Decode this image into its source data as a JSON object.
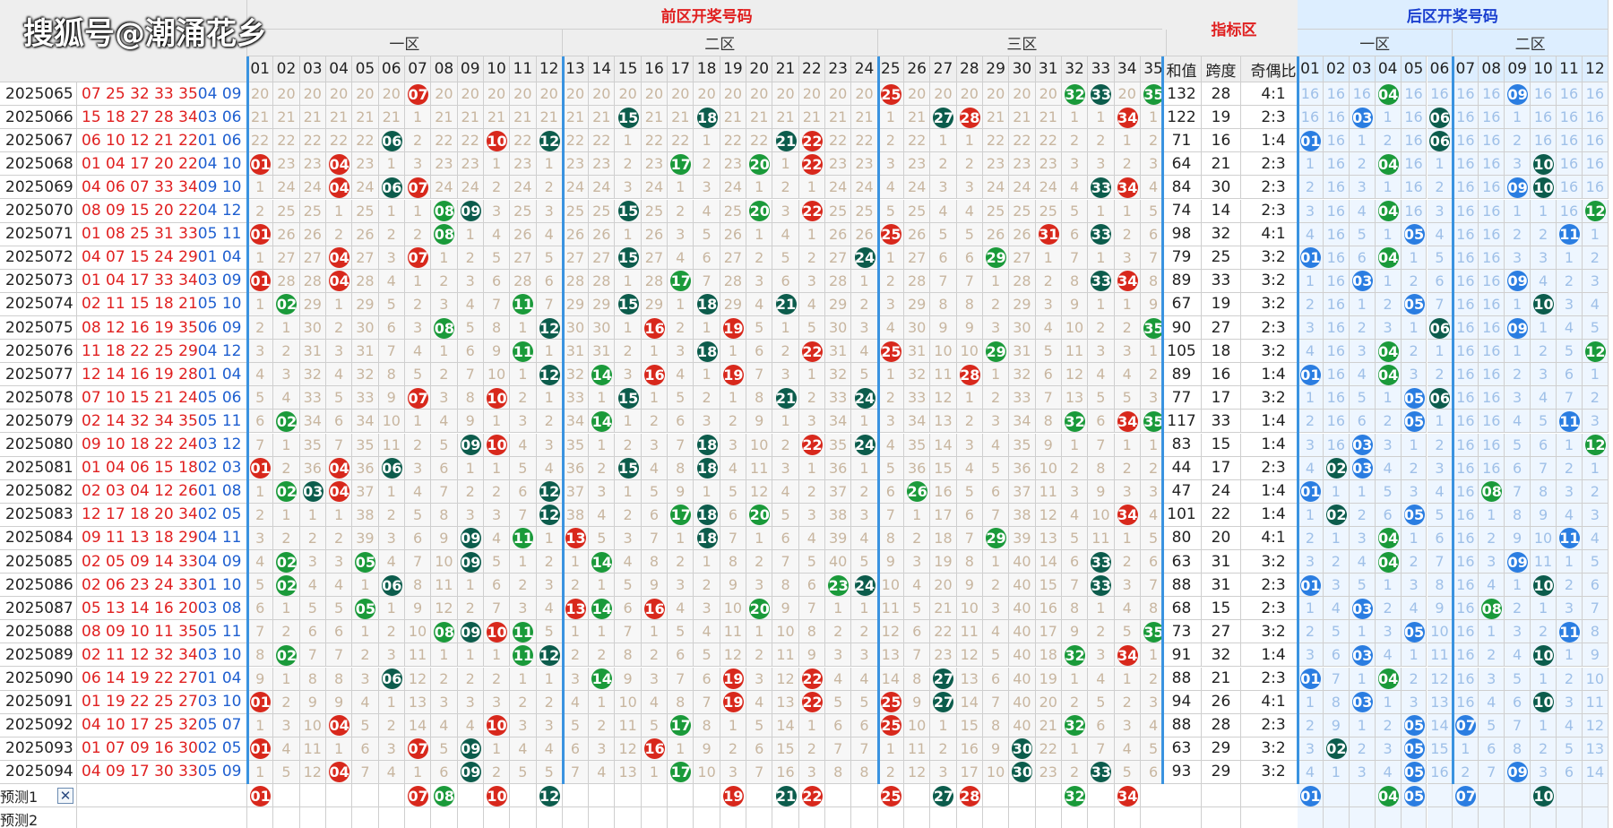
{
  "watermark": "搜狐号@潮涌花乡",
  "header": {
    "front_title": "前区开奖号码",
    "indicator_title": "指标区",
    "back_title": "后区开奖号码",
    "front_zones": [
      "一区",
      "二区",
      "三区"
    ],
    "back_zones": [
      "一区",
      "二区"
    ],
    "indicator_cols": [
      "和值",
      "跨度",
      "奇偶比"
    ],
    "front_numbers": [
      "01",
      "02",
      "03",
      "04",
      "05",
      "06",
      "07",
      "08",
      "09",
      "10",
      "11",
      "12",
      "13",
      "14",
      "15",
      "16",
      "17",
      "18",
      "19",
      "20",
      "21",
      "22",
      "23",
      "24",
      "25",
      "26",
      "27",
      "28",
      "29",
      "30",
      "31",
      "32",
      "33",
      "34",
      "35"
    ],
    "back_numbers": [
      "01",
      "02",
      "03",
      "04",
      "05",
      "06",
      "07",
      "08",
      "09",
      "10",
      "11",
      "12"
    ]
  },
  "colors": {
    "red": "#d8281c",
    "green": "#1a9a3a",
    "dark": "#0c5c4c",
    "blue": "#2a7de1",
    "accent_line": "#3a93e0"
  },
  "rows": [
    {
      "issue": "2025065",
      "front": "07 25 32 33 35",
      "back": "04 09",
      "sum": "132",
      "span": "28",
      "ratio": "4:1"
    },
    {
      "issue": "2025066",
      "front": "15 18 27 28 34",
      "back": "03 06",
      "sum": "122",
      "span": "19",
      "ratio": "2:3"
    },
    {
      "issue": "2025067",
      "front": "06 10 12 21 22",
      "back": "01 06",
      "sum": "71",
      "span": "16",
      "ratio": "1:4"
    },
    {
      "issue": "2025068",
      "front": "01 04 17 20 22",
      "back": "04 10",
      "sum": "64",
      "span": "21",
      "ratio": "2:3"
    },
    {
      "issue": "2025069",
      "front": "04 06 07 33 34",
      "back": "09 10",
      "sum": "84",
      "span": "30",
      "ratio": "2:3"
    },
    {
      "issue": "2025070",
      "front": "08 09 15 20 22",
      "back": "04 12",
      "sum": "74",
      "span": "14",
      "ratio": "2:3"
    },
    {
      "issue": "2025071",
      "front": "01 08 25 31 33",
      "back": "05 11",
      "sum": "98",
      "span": "32",
      "ratio": "4:1"
    },
    {
      "issue": "2025072",
      "front": "04 07 15 24 29",
      "back": "01 04",
      "sum": "79",
      "span": "25",
      "ratio": "3:2"
    },
    {
      "issue": "2025073",
      "front": "01 04 17 33 34",
      "back": "03 09",
      "sum": "89",
      "span": "33",
      "ratio": "3:2"
    },
    {
      "issue": "2025074",
      "front": "02 11 15 18 21",
      "back": "05 10",
      "sum": "67",
      "span": "19",
      "ratio": "3:2"
    },
    {
      "issue": "2025075",
      "front": "08 12 16 19 35",
      "back": "06 09",
      "sum": "90",
      "span": "27",
      "ratio": "2:3"
    },
    {
      "issue": "2025076",
      "front": "11 18 22 25 29",
      "back": "04 12",
      "sum": "105",
      "span": "18",
      "ratio": "3:2"
    },
    {
      "issue": "2025077",
      "front": "12 14 16 19 28",
      "back": "01 04",
      "sum": "89",
      "span": "16",
      "ratio": "1:4"
    },
    {
      "issue": "2025078",
      "front": "07 10 15 21 24",
      "back": "05 06",
      "sum": "77",
      "span": "17",
      "ratio": "3:2"
    },
    {
      "issue": "2025079",
      "front": "02 14 32 34 35",
      "back": "05 11",
      "sum": "117",
      "span": "33",
      "ratio": "1:4"
    },
    {
      "issue": "2025080",
      "front": "09 10 18 22 24",
      "back": "03 12",
      "sum": "83",
      "span": "15",
      "ratio": "1:4"
    },
    {
      "issue": "2025081",
      "front": "01 04 06 15 18",
      "back": "02 03",
      "sum": "44",
      "span": "17",
      "ratio": "2:3"
    },
    {
      "issue": "2025082",
      "front": "02 03 04 12 26",
      "back": "01 08",
      "sum": "47",
      "span": "24",
      "ratio": "1:4"
    },
    {
      "issue": "2025083",
      "front": "12 17 18 20 34",
      "back": "02 05",
      "sum": "101",
      "span": "22",
      "ratio": "1:4"
    },
    {
      "issue": "2025084",
      "front": "09 11 13 18 29",
      "back": "04 11",
      "sum": "80",
      "span": "20",
      "ratio": "4:1"
    },
    {
      "issue": "2025085",
      "front": "02 05 09 14 33",
      "back": "04 09",
      "sum": "63",
      "span": "31",
      "ratio": "3:2"
    },
    {
      "issue": "2025086",
      "front": "02 06 23 24 33",
      "back": "01 10",
      "sum": "88",
      "span": "31",
      "ratio": "2:3"
    },
    {
      "issue": "2025087",
      "front": "05 13 14 16 20",
      "back": "03 08",
      "sum": "68",
      "span": "15",
      "ratio": "2:3"
    },
    {
      "issue": "2025088",
      "front": "08 09 10 11 35",
      "back": "05 11",
      "sum": "73",
      "span": "27",
      "ratio": "3:2"
    },
    {
      "issue": "2025089",
      "front": "02 11 12 32 34",
      "back": "03 10",
      "sum": "91",
      "span": "32",
      "ratio": "1:4"
    },
    {
      "issue": "2025090",
      "front": "06 14 19 22 27",
      "back": "01 04",
      "sum": "88",
      "span": "21",
      "ratio": "2:3"
    },
    {
      "issue": "2025091",
      "front": "01 19 22 25 27",
      "back": "03 10",
      "sum": "94",
      "span": "26",
      "ratio": "4:1"
    },
    {
      "issue": "2025092",
      "front": "04 10 17 25 32",
      "back": "05 07",
      "sum": "88",
      "span": "28",
      "ratio": "2:3"
    },
    {
      "issue": "2025093",
      "front": "01 07 09 16 30",
      "back": "02 05",
      "sum": "63",
      "span": "29",
      "ratio": "3:2"
    },
    {
      "issue": "2025094",
      "front": "04 09 17 30 33",
      "back": "05 09",
      "sum": "93",
      "span": "29",
      "ratio": "3:2"
    }
  ],
  "predictions": [
    {
      "label": "预测1",
      "close": "✕",
      "front": [
        "01",
        "07",
        "08",
        "10",
        "12",
        "19",
        "21",
        "22",
        "25",
        "27",
        "28",
        "32",
        "34"
      ],
      "back": [
        "01",
        "04",
        "05",
        "07",
        "10"
      ]
    },
    {
      "label": "预测2",
      "front": [],
      "back": []
    }
  ]
}
